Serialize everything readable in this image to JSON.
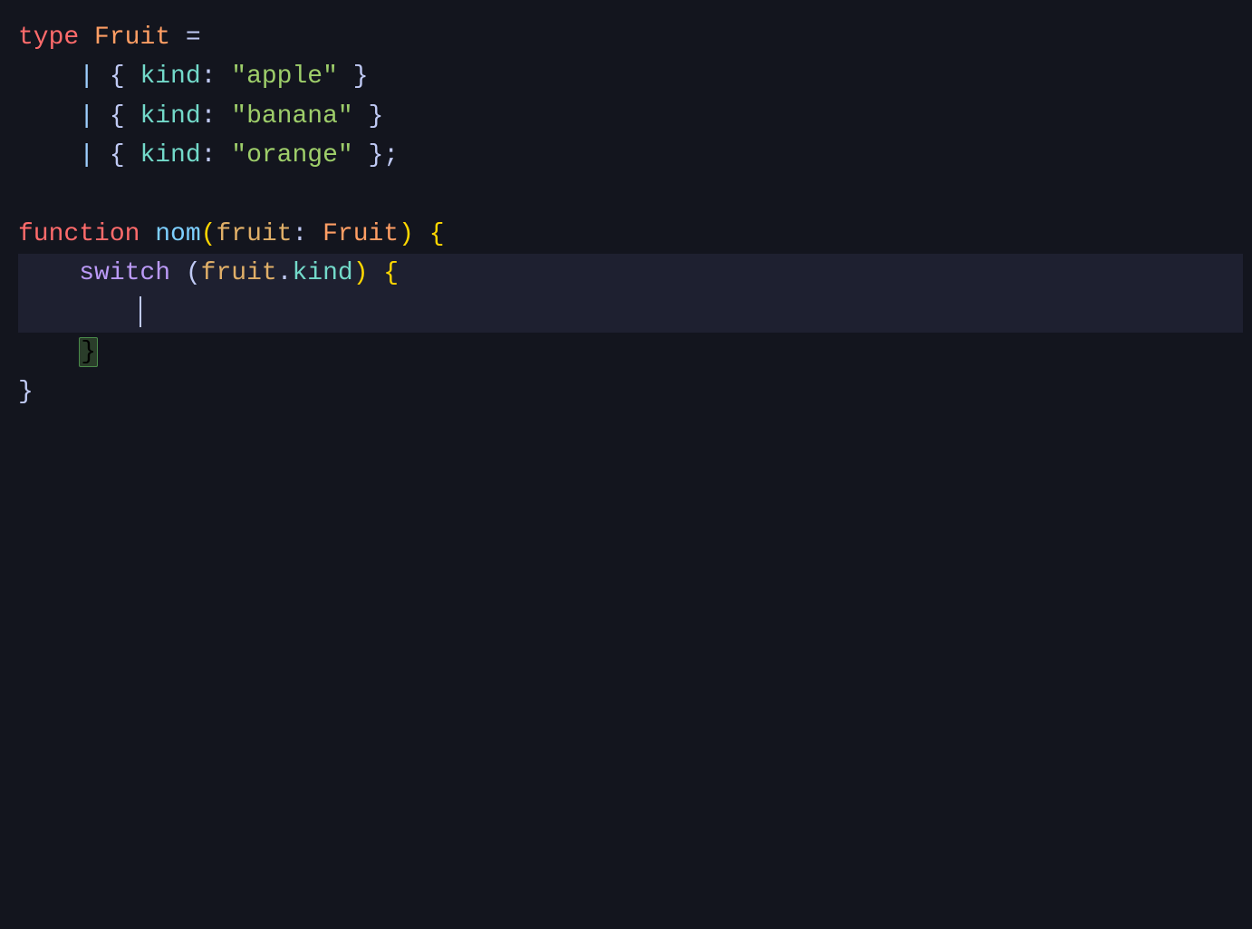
{
  "editor": {
    "background": "#13151e",
    "lines": [
      {
        "id": "line1",
        "content": "type Fruit =",
        "tokens": [
          {
            "text": "type",
            "class": "kw-type"
          },
          {
            "text": " ",
            "class": "plain"
          },
          {
            "text": "Fruit",
            "class": "type-name"
          },
          {
            "text": " =",
            "class": "plain"
          }
        ]
      },
      {
        "id": "line2",
        "content": "    | { kind: \"apple\" }",
        "indent": 1,
        "tokens": [
          {
            "text": "| ",
            "class": "pipe"
          },
          {
            "text": "{ ",
            "class": "brace"
          },
          {
            "text": "kind",
            "class": "key"
          },
          {
            "text": ": ",
            "class": "colon"
          },
          {
            "text": "\"apple\"",
            "class": "str"
          },
          {
            "text": " }",
            "class": "brace"
          }
        ]
      },
      {
        "id": "line3",
        "content": "    | { kind: \"banana\" }",
        "indent": 1,
        "tokens": [
          {
            "text": "| ",
            "class": "pipe"
          },
          {
            "text": "{ ",
            "class": "brace"
          },
          {
            "text": "kind",
            "class": "key"
          },
          {
            "text": ": ",
            "class": "colon"
          },
          {
            "text": "\"banana\"",
            "class": "str"
          },
          {
            "text": " }",
            "class": "brace"
          }
        ]
      },
      {
        "id": "line4",
        "content": "    | { kind: \"orange\" };",
        "indent": 1,
        "tokens": [
          {
            "text": "| ",
            "class": "pipe"
          },
          {
            "text": "{ ",
            "class": "brace"
          },
          {
            "text": "kind",
            "class": "key"
          },
          {
            "text": ": ",
            "class": "colon"
          },
          {
            "text": "\"orange\"",
            "class": "str"
          },
          {
            "text": " }",
            "class": "brace"
          },
          {
            "text": ";",
            "class": "semi"
          }
        ]
      },
      {
        "id": "line5",
        "content": "",
        "tokens": []
      },
      {
        "id": "line6",
        "content": "function nom(fruit: Fruit) {",
        "tokens": [
          {
            "text": "function",
            "class": "kw-fn"
          },
          {
            "text": " ",
            "class": "plain"
          },
          {
            "text": "nom",
            "class": "fn-name"
          },
          {
            "text": "(",
            "class": "paren"
          },
          {
            "text": "fruit",
            "class": "param"
          },
          {
            "text": ": ",
            "class": "plain"
          },
          {
            "text": "Fruit",
            "class": "type-name"
          },
          {
            "text": ") {",
            "class": "paren"
          }
        ]
      },
      {
        "id": "line7",
        "content": "    switch (fruit.kind) {",
        "highlighted": true,
        "tokens": [
          {
            "text": "    ",
            "class": "plain"
          },
          {
            "text": "switch",
            "class": "kw-switch"
          },
          {
            "text": " (",
            "class": "plain"
          },
          {
            "text": "fruit",
            "class": "param"
          },
          {
            "text": ".",
            "class": "dot"
          },
          {
            "text": "kind",
            "class": "prop"
          },
          {
            "text": ") {",
            "class": "paren"
          }
        ]
      },
      {
        "id": "line8",
        "content": "        |cursor|",
        "highlighted": true,
        "hasCursor": true,
        "tokens": [
          {
            "text": "        ",
            "class": "plain"
          }
        ]
      },
      {
        "id": "line9",
        "content": "    }",
        "tokens": [
          {
            "text": "    ",
            "class": "plain"
          },
          {
            "text": "}",
            "class": "bracket-highlight",
            "highlight": true
          }
        ]
      },
      {
        "id": "line10",
        "content": "}",
        "tokens": [
          {
            "text": "}",
            "class": "plain"
          }
        ]
      }
    ]
  }
}
